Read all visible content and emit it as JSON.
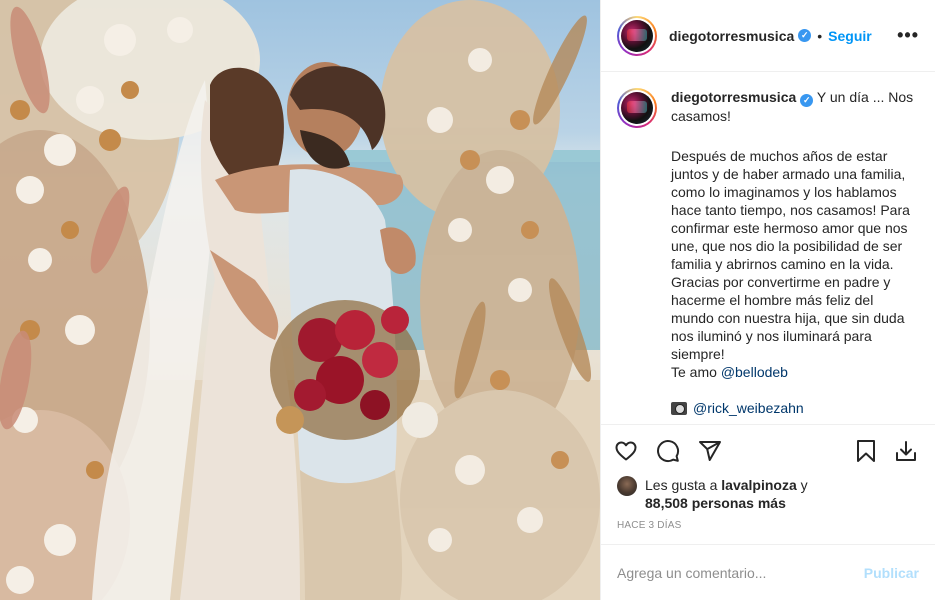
{
  "post": {
    "username": "diegotorresmusica",
    "verified_mark": "✓",
    "follow_label": "Seguir",
    "separator": "•",
    "more_label": "•••",
    "photo_alt": "Foto de boda en la playa"
  },
  "caption": {
    "username": "diegotorresmusica",
    "title": "Y un día ... Nos casamos!",
    "body": "Después de muchos años de estar juntos y de haber armado una familia, como lo imaginamos y los hablamos hace tanto tiempo, nos casamos! Para confirmar este hermoso amor que nos une, que nos dio la posibilidad de ser familia y abrirnos camino en la vida. Gracias por convertirme en padre y hacerme el hombre más feliz del mundo con nuestra hija, que sin duda nos iluminó y nos iluminará para siempre!",
    "love_prefix": "Te amo ",
    "love_mention": "@bellodeb",
    "credit_mention": "@rick_weibezahn"
  },
  "actions": {
    "like_icon": "heart-icon",
    "comment_icon": "comment-icon",
    "share_icon": "share-icon",
    "save_icon": "bookmark-icon",
    "download_icon": "download-icon"
  },
  "likes": {
    "prefix": "Les gusta a ",
    "user": "lavalpinoza",
    "conj": " y",
    "count": "88,508 personas más"
  },
  "timestamp": "Hace 3 días",
  "comment": {
    "placeholder": "Agrega un comentario...",
    "publish_label": "Publicar"
  },
  "colors": {
    "link_blue": "#0095f6",
    "publish_disabled": "#b2dffc",
    "muted": "#8e8e8e"
  }
}
